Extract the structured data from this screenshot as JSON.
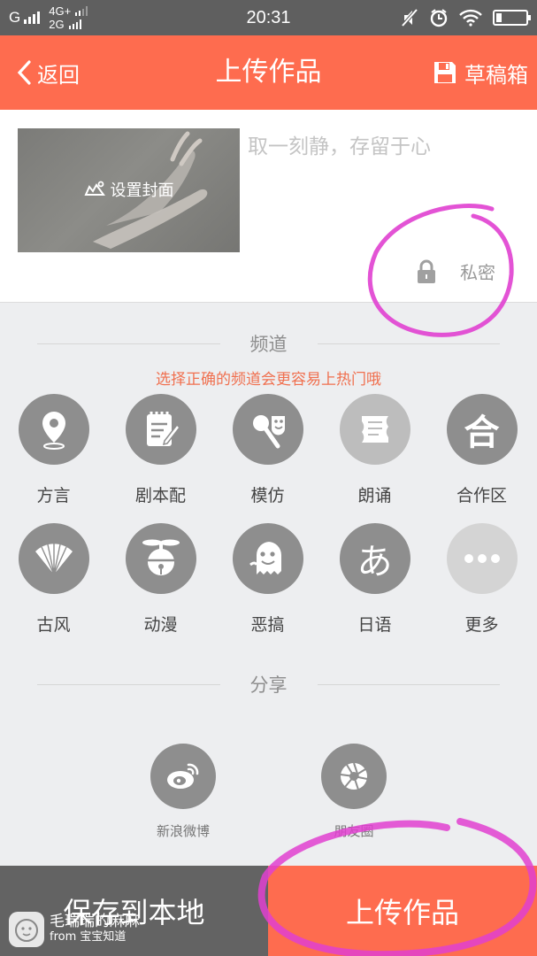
{
  "status_bar": {
    "carrier1": "G",
    "net_primary": "4G+",
    "net_secondary": "2G",
    "time": "20:31",
    "battery_level": 0.18,
    "icons": [
      "signal-icon",
      "mute-icon",
      "alarm-icon",
      "wifi-icon",
      "battery-icon"
    ]
  },
  "header": {
    "back_label": "返回",
    "title": "上传作品",
    "drafts_label": "草稿箱"
  },
  "post": {
    "cover_label": "设置封面",
    "caption_placeholder": "取一刻静，存留于心",
    "privacy_label": "私密"
  },
  "channels": {
    "heading": "频道",
    "tip": "选择正确的频道会更容易上热门哦",
    "tip_color": "#f0704f",
    "items": [
      {
        "label": "方言",
        "icon": "location-pin-icon"
      },
      {
        "label": "剧本配",
        "icon": "notepad-icon"
      },
      {
        "label": "模仿",
        "icon": "microphone-mask-icon"
      },
      {
        "label": "朗诵",
        "icon": "scroll-icon"
      },
      {
        "label": "合作区",
        "icon": "he-character-icon",
        "glyph": "合"
      },
      {
        "label": "古风",
        "icon": "folding-fan-icon"
      },
      {
        "label": "动漫",
        "icon": "bell-propeller-icon"
      },
      {
        "label": "恶搞",
        "icon": "ghost-icon"
      },
      {
        "label": "日语",
        "icon": "hiragana-a-icon",
        "glyph": "あ"
      },
      {
        "label": "更多",
        "icon": "more-dots-icon"
      }
    ]
  },
  "share": {
    "heading": "分享",
    "items": [
      {
        "label": "新浪微博",
        "icon": "weibo-icon"
      },
      {
        "label": "朋友圈",
        "icon": "moments-icon"
      }
    ]
  },
  "footer": {
    "save_label": "保存到本地",
    "upload_label": "上传作品"
  },
  "watermark": {
    "name": "毛瑞瑞的麻麻",
    "source": "from 宝宝知道"
  },
  "colors": {
    "accent": "#fe6c4f",
    "status_bar": "#5f5f5f",
    "save_button": "#636363",
    "icon_gray": "#8e8e8e",
    "annotation_magenta": "#e040d0"
  }
}
